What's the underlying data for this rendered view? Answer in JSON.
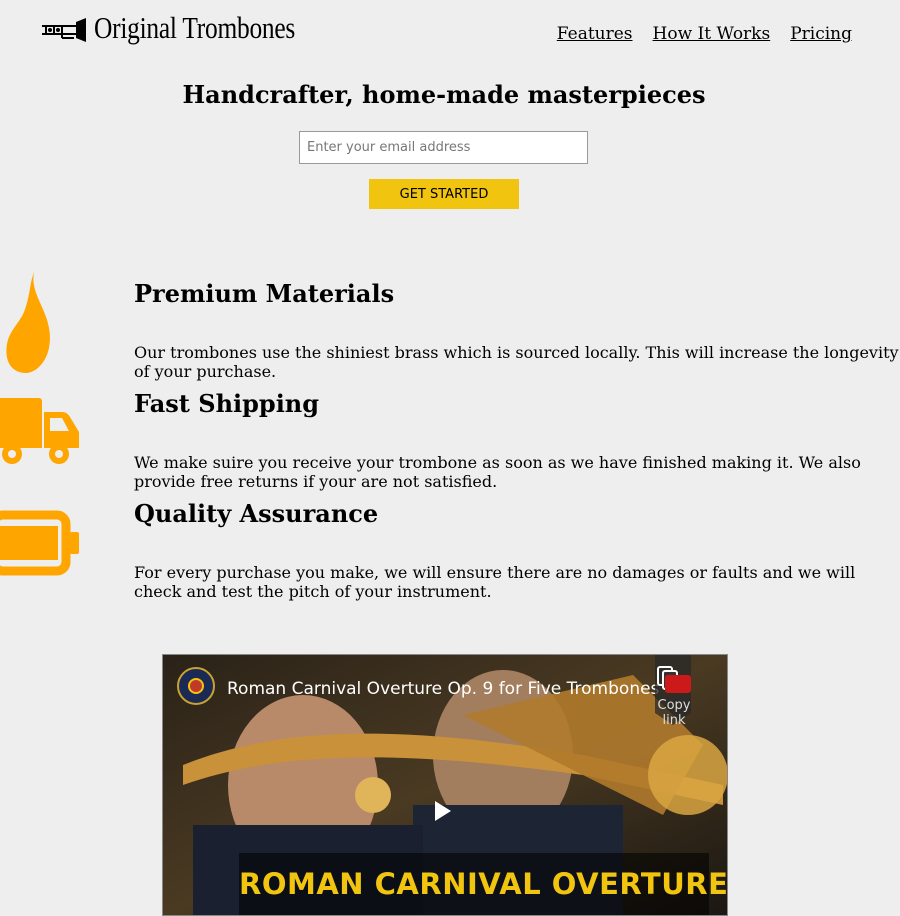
{
  "brand": {
    "name": "Original Trombones",
    "icon": "trombone-icon"
  },
  "nav": {
    "items": [
      "Features",
      "How It Works",
      "Pricing"
    ]
  },
  "hero": {
    "title": "Handcrafter, home-made masterpieces",
    "email_placeholder": "Enter your email address",
    "cta_label": "GET STARTED",
    "cta_color": "#f1c40f"
  },
  "accent_color": "#ffa500",
  "features": [
    {
      "icon": "fire-icon",
      "title": "Premium Materials",
      "text": "Our trombones use the shiniest brass which is sourced locally. This will increase the longevity of your purchase."
    },
    {
      "icon": "truck-icon",
      "title": "Fast Shipping",
      "text": "We make suire you receive your trombone as soon as we have finished making it. We also provide free returns if your are not satisfied."
    },
    {
      "icon": "battery-icon",
      "title": "Quality Assurance",
      "text": "For every purchase you make, we will ensure there are no damages or faults and we will check and test the pitch of your instrument."
    }
  ],
  "video": {
    "title": "Roman Carnival Overture Op. 9 for Five Trombones",
    "copy_label": "Copy link",
    "caption": "ROMAN CARNIVAL OVERTURE"
  }
}
